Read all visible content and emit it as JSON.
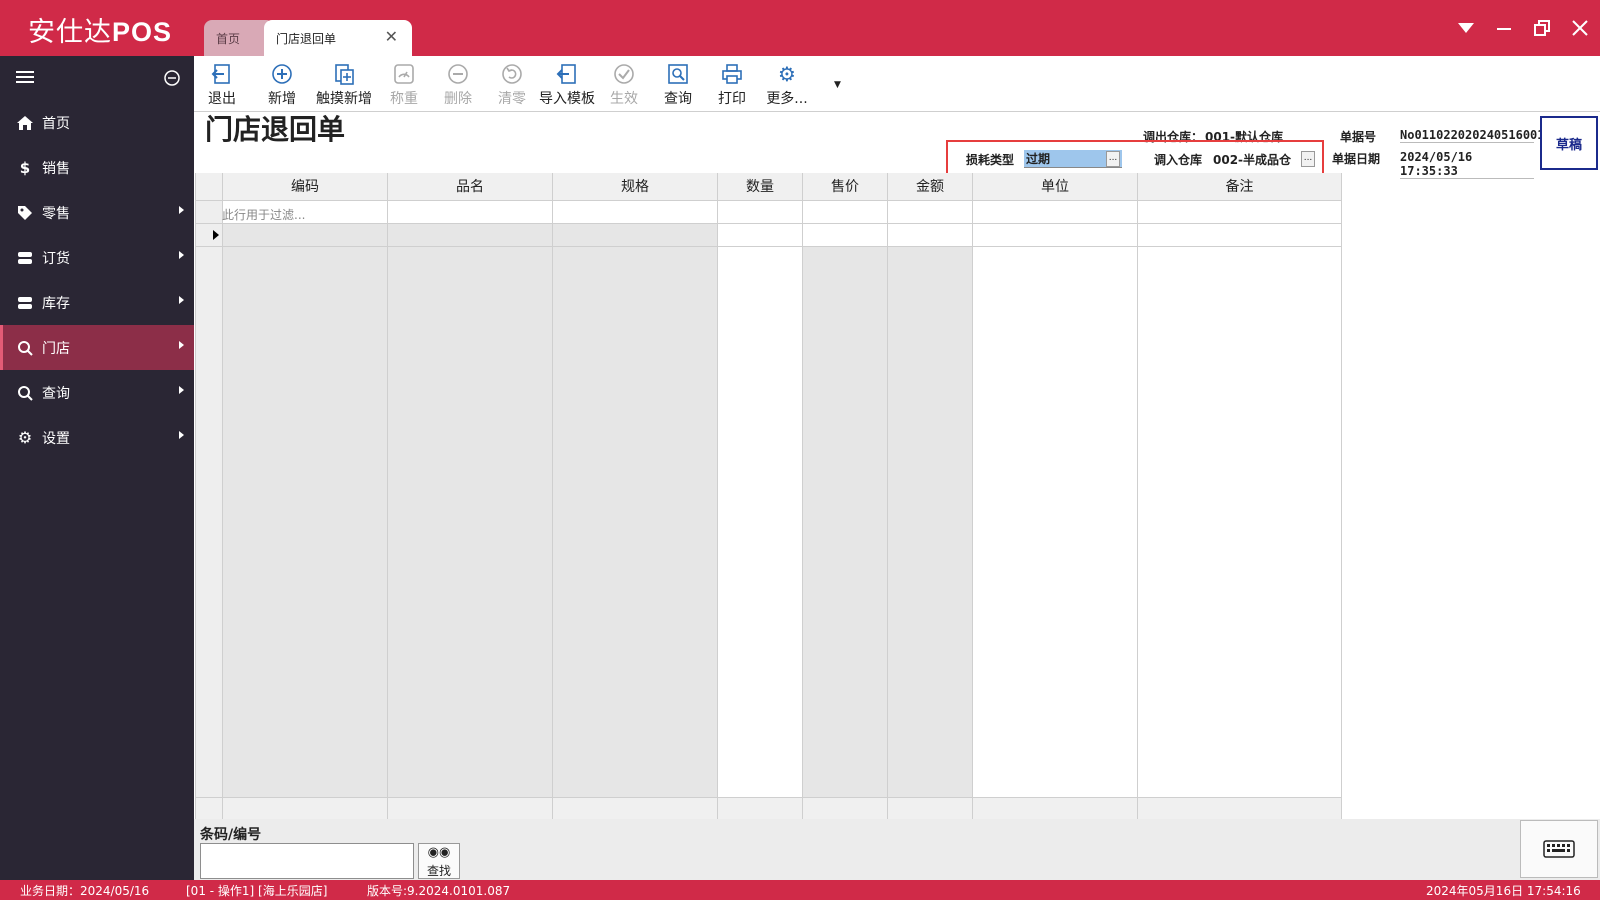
{
  "app": {
    "title_cn": "安仕达",
    "title_en": "POS",
    "accent": "#d02a48"
  },
  "tabs": [
    {
      "label": "首页"
    },
    {
      "label": "门店退回单",
      "active": true
    }
  ],
  "window_controls": [
    "dropdown-icon",
    "minimize-icon",
    "restore-icon",
    "close-icon"
  ],
  "sidebar": {
    "items": [
      {
        "label": "首页",
        "icon": "home-icon"
      },
      {
        "label": "销售",
        "icon": "dollar-icon"
      },
      {
        "label": "零售",
        "icon": "tag-icon"
      },
      {
        "label": "订货",
        "icon": "database-icon"
      },
      {
        "label": "库存",
        "icon": "database-icon"
      },
      {
        "label": "门店",
        "icon": "search-icon",
        "active": true
      },
      {
        "label": "查询",
        "icon": "search-icon"
      },
      {
        "label": "设置",
        "icon": "gear-icon"
      }
    ]
  },
  "toolbar": {
    "buttons": [
      {
        "label": "退出",
        "icon": "exit-icon",
        "enabled": true
      },
      {
        "label": "新增",
        "icon": "plus-circle-icon",
        "enabled": true
      },
      {
        "label": "触摸新增",
        "icon": "touch-add-icon",
        "enabled": true
      },
      {
        "label": "称重",
        "icon": "scale-icon",
        "enabled": false
      },
      {
        "label": "删除",
        "icon": "minus-circle-icon",
        "enabled": false
      },
      {
        "label": "清零",
        "icon": "reset-icon",
        "enabled": false
      },
      {
        "label": "导入模板",
        "icon": "import-icon",
        "enabled": true
      },
      {
        "label": "生效",
        "icon": "check-circle-icon",
        "enabled": false
      },
      {
        "label": "查询",
        "icon": "search-doc-icon",
        "enabled": true
      },
      {
        "label": "打印",
        "icon": "printer-icon",
        "enabled": true
      },
      {
        "label": "更多...",
        "icon": "gear-icon",
        "enabled": true
      }
    ]
  },
  "form": {
    "title": "门店退回单",
    "out_warehouse_label": "调出仓库：",
    "out_warehouse_value": "001-默认仓库",
    "loss_type_label": "损耗类型",
    "loss_type_value": "过期",
    "in_warehouse_label": "调入仓库",
    "in_warehouse_value": "002-半成品仓",
    "doc_no_label": "单据号",
    "doc_no_value": "No011022020240516001",
    "doc_date_label": "单据日期",
    "doc_date_value": "2024/05/16 17:35:33",
    "status": "草稿"
  },
  "grid": {
    "columns": [
      "编码",
      "品名",
      "规格",
      "数量",
      "售价",
      "金额",
      "单位",
      "备注"
    ],
    "filter_placeholder": "此行用于过滤..."
  },
  "barcode": {
    "label": "条码/编号",
    "value": "",
    "find_label": "查找"
  },
  "statusbar": {
    "business_date": "业务日期：2024/05/16",
    "operator": "[01 - 操作1]  [海上乐园店]",
    "version": "版本号:9.2024.0101.087",
    "datetime": "2024年05月16日 17:54:16"
  }
}
